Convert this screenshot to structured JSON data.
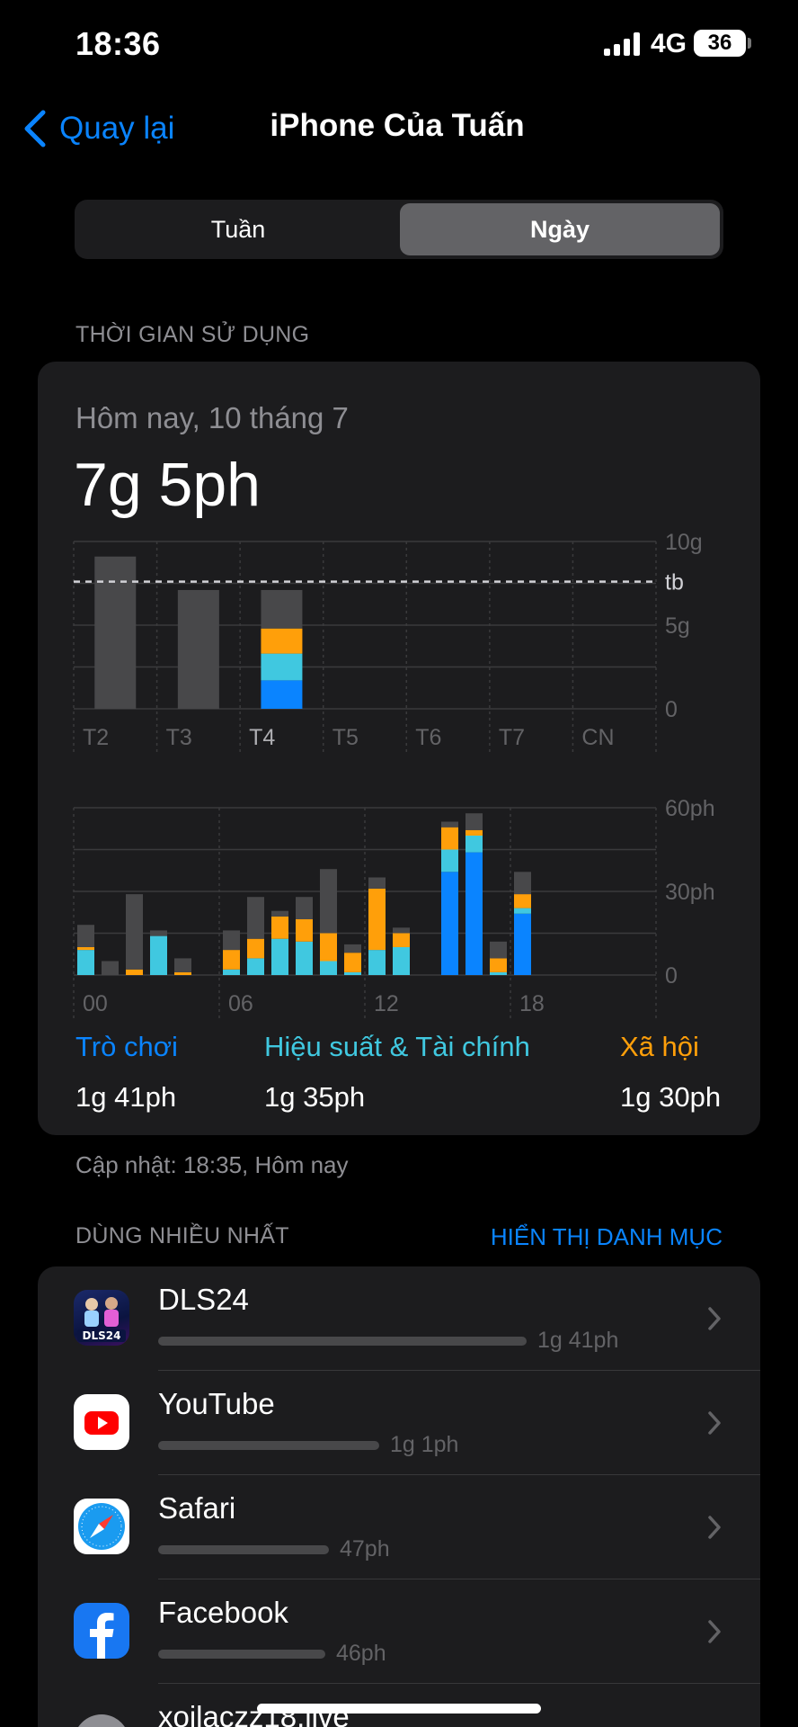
{
  "status_bar": {
    "time": "18:36",
    "network": "4G",
    "battery": "36"
  },
  "nav": {
    "back_label": "Quay lại",
    "title": "iPhone Của Tuấn"
  },
  "segments": {
    "week": "Tuần",
    "day": "Ngày",
    "selected": "Ngày"
  },
  "usage_section_label": "THỜI GIAN SỬ DỤNG",
  "usage": {
    "date": "Hôm nay, 10 tháng 7",
    "total": "7g 5ph"
  },
  "colors": {
    "games": "#0a84ff",
    "productivity": "#40c8e0",
    "social": "#ff9f0a",
    "other": "#48484a",
    "accent": "#0a84ff"
  },
  "chart_data": [
    {
      "type": "bar",
      "stacked": true,
      "categories": [
        "T2",
        "T3",
        "T4",
        "T5",
        "T6",
        "T7",
        "CN"
      ],
      "y_tick_labels": [
        "10g",
        "tb",
        "5g",
        "0"
      ],
      "ylim_hours": [
        0,
        10
      ],
      "average_line_hours": 7.6,
      "grid": true,
      "series": [
        {
          "name": "Trò chơi",
          "color": "#0a84ff",
          "values": [
            0,
            0,
            1.7,
            0,
            0,
            0,
            0
          ]
        },
        {
          "name": "Hiệu suất & Tài chính",
          "color": "#40c8e0",
          "values": [
            0,
            0,
            1.6,
            0,
            0,
            0,
            0
          ]
        },
        {
          "name": "Xã hội",
          "color": "#ff9f0a",
          "values": [
            0,
            0,
            1.5,
            0,
            0,
            0,
            0
          ]
        },
        {
          "color": "#48484a",
          "values": [
            9.1,
            7.1,
            2.3,
            0,
            0,
            0,
            0
          ]
        }
      ]
    },
    {
      "type": "bar",
      "stacked": true,
      "x_tick_labels": [
        "00",
        "06",
        "12",
        "18"
      ],
      "y_tick_labels": [
        "60ph",
        "30ph",
        "0"
      ],
      "ylim_minutes": [
        0,
        60
      ],
      "grid": true,
      "hours": [
        0,
        1,
        2,
        3,
        4,
        5,
        6,
        7,
        8,
        9,
        10,
        11,
        12,
        13,
        14,
        15,
        16,
        17,
        18,
        19,
        20,
        21,
        22,
        23
      ],
      "series": [
        {
          "name": "Trò chơi",
          "color": "#0a84ff",
          "values": [
            0,
            0,
            0,
            0,
            0,
            0,
            0,
            0,
            0,
            0,
            0,
            0,
            0,
            0,
            0,
            37,
            44,
            0,
            22,
            0,
            0,
            0,
            0,
            0
          ]
        },
        {
          "name": "Hiệu suất & Tài chính",
          "color": "#40c8e0",
          "values": [
            9,
            0,
            0,
            14,
            0,
            0,
            2,
            6,
            13,
            12,
            5,
            1,
            9,
            10,
            0,
            8,
            6,
            1,
            2,
            0,
            0,
            0,
            0,
            0
          ]
        },
        {
          "name": "Xã hội",
          "color": "#ff9f0a",
          "values": [
            1,
            0,
            2,
            0,
            1,
            0,
            7,
            7,
            8,
            8,
            10,
            7,
            22,
            5,
            0,
            8,
            2,
            5,
            5,
            0,
            0,
            0,
            0,
            0
          ]
        },
        {
          "color": "#48484a",
          "values": [
            8,
            5,
            27,
            2,
            5,
            0,
            7,
            15,
            2,
            8,
            23,
            3,
            4,
            2,
            0,
            2,
            6,
            6,
            8,
            0,
            0,
            0,
            0,
            0
          ]
        }
      ]
    }
  ],
  "legend": [
    {
      "name": "Trò chơi",
      "value": "1g 41ph",
      "color": "#0a84ff"
    },
    {
      "name": "Hiệu suất & Tài chính",
      "value": "1g 35ph",
      "color": "#40c8e0"
    },
    {
      "name": "Xã hội",
      "value": "1g 30ph",
      "color": "#ff9f0a"
    }
  ],
  "updated": "Cập nhật: 18:35, Hôm nay",
  "most_used": {
    "label": "DÙNG NHIỀU NHẤT",
    "show_categories": "HIỂN THỊ DANH MỤC",
    "apps": [
      {
        "name": "DLS24",
        "time": "1g 41ph",
        "minutes": 101,
        "icon": "dls24-app-icon"
      },
      {
        "name": "YouTube",
        "time": "1g 1ph",
        "minutes": 61,
        "icon": "youtube-app-icon"
      },
      {
        "name": "Safari",
        "time": "47ph",
        "minutes": 47,
        "icon": "safari-app-icon"
      },
      {
        "name": "Facebook",
        "time": "46ph",
        "minutes": 46,
        "icon": "facebook-app-icon"
      },
      {
        "name": "xoilaczz18.live",
        "time": "",
        "minutes": 0,
        "icon": "website-icon"
      }
    ]
  }
}
